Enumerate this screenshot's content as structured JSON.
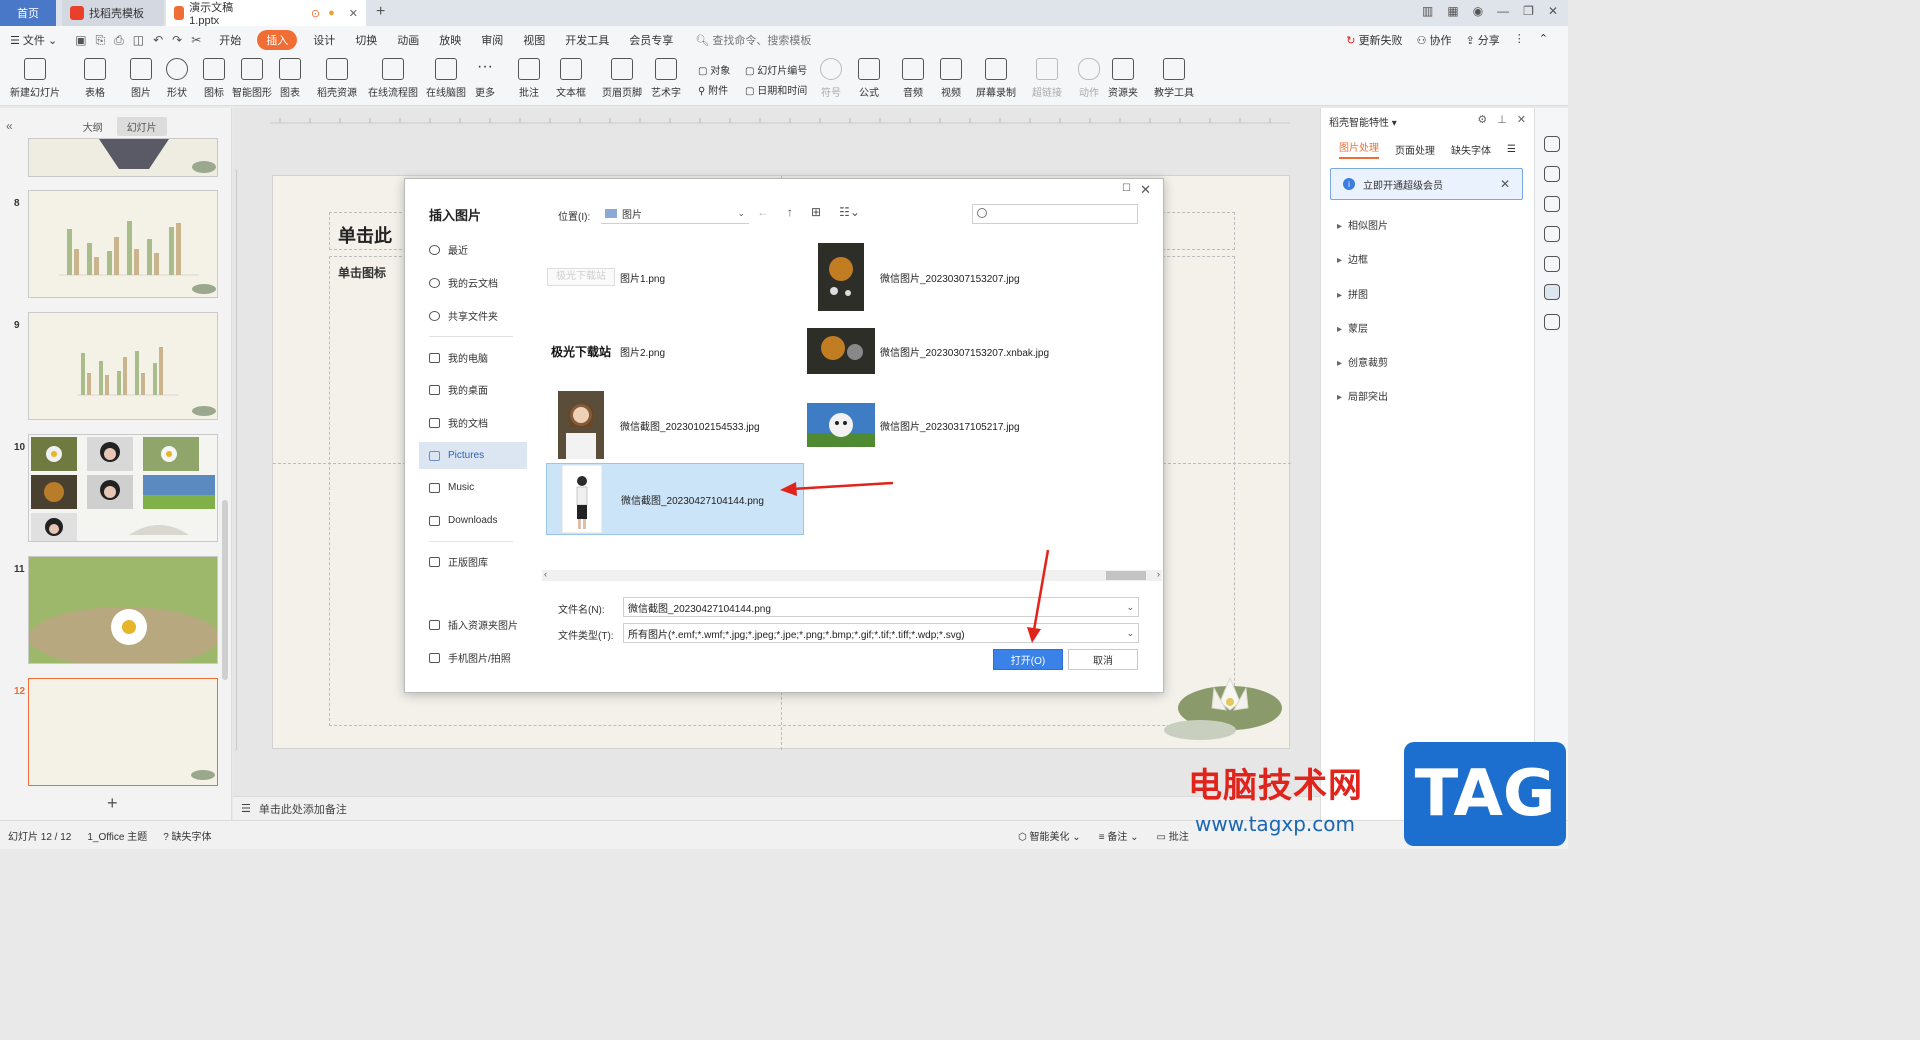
{
  "titlebar": {
    "tabs": [
      {
        "label": "首页"
      },
      {
        "label": "找稻壳模板"
      },
      {
        "label": "演示文稿1.pptx"
      }
    ],
    "add_tab": "+"
  },
  "menubar": {
    "file": "文件",
    "items": [
      "开始",
      "插入",
      "设计",
      "切换",
      "动画",
      "放映",
      "审阅",
      "视图",
      "开发工具",
      "会员专享"
    ],
    "active": "插入",
    "search": "查找命令、搜索模板",
    "right": [
      "更新失败",
      "协作",
      "分享"
    ]
  },
  "ribbon": {
    "buttons": [
      "新建幻灯片",
      "表格",
      "图片",
      "形状",
      "图标",
      "智能图形",
      "图表",
      "稻壳资源",
      "在线流程图",
      "在线脑图",
      "更多",
      "批注",
      "文本框",
      "页眉页脚",
      "艺术字",
      "符号",
      "公式",
      "音频",
      "视频",
      "屏幕录制",
      "超链接",
      "动作",
      "资源夹",
      "教学工具"
    ],
    "small": [
      "对象",
      "附件",
      "幻灯片编号",
      "日期和时间"
    ]
  },
  "left_pane": {
    "tabs": [
      "大纲",
      "幻灯片"
    ],
    "active_tab": "幻灯片",
    "slides": [
      "8",
      "9",
      "10",
      "11",
      "12"
    ],
    "selected": "12",
    "add": "+"
  },
  "slide": {
    "title": "单击此",
    "subtitle": "单击图标"
  },
  "notes": "单击此处添加备注",
  "right_pane": {
    "title": "稻壳智能特性",
    "tabs": [
      "图片处理",
      "页面处理",
      "缺失字体"
    ],
    "active_tab": "图片处理",
    "vip": "立即开通超级会员",
    "items": [
      "相似图片",
      "边框",
      "拼图",
      "蒙层",
      "创意裁剪",
      "局部突出"
    ]
  },
  "statusbar": {
    "slide_info": "幻灯片 12 / 12",
    "theme": "1_Office 主题",
    "missing_font": "缺失字体",
    "beautify": "智能美化",
    "notes": "备注",
    "comments": "批注"
  },
  "dialog": {
    "title": "插入图片",
    "nav": [
      "最近",
      "我的云文档",
      "共享文件夹",
      "我的电脑",
      "我的桌面",
      "我的文档",
      "Pictures",
      "Music",
      "Downloads",
      "正版图库",
      "插入资源夹图片",
      "手机图片/拍照"
    ],
    "nav_selected": "Pictures",
    "location_label": "位置(I):",
    "location_value": "图片",
    "files": [
      {
        "name": "图片1.png",
        "thumb_text": "极光下载站"
      },
      {
        "name": "微信图片_20230307153207.jpg"
      },
      {
        "name": "图片2.png",
        "thumb_text": "极光下载站"
      },
      {
        "name": "微信图片_20230307153207.xnbak.jpg"
      },
      {
        "name": "微信截图_20230102154533.jpg"
      },
      {
        "name": "微信图片_20230317105217.jpg"
      },
      {
        "name": "微信截图_20230427104144.png"
      }
    ],
    "selected_file": "微信截图_20230427104144.png",
    "filename_label": "文件名(N):",
    "filename_value": "微信截图_20230427104144.png",
    "filetype_label": "文件类型(T):",
    "filetype_value": "所有图片(*.emf;*.wmf;*.jpg;*.jpeg;*.jpe;*.png;*.bmp;*.gif;*.tif;*.tiff;*.wdp;*.svg)",
    "open": "打开(O)",
    "cancel": "取消"
  },
  "watermark": {
    "text": "电脑技术网",
    "url": "www.tagxp.com",
    "badge": "TAG"
  },
  "colors": {
    "accent": "#f06e36",
    "selected_blue": "#cce4f7",
    "open_button": "#3b82e8",
    "arrow": "#e0231b"
  }
}
